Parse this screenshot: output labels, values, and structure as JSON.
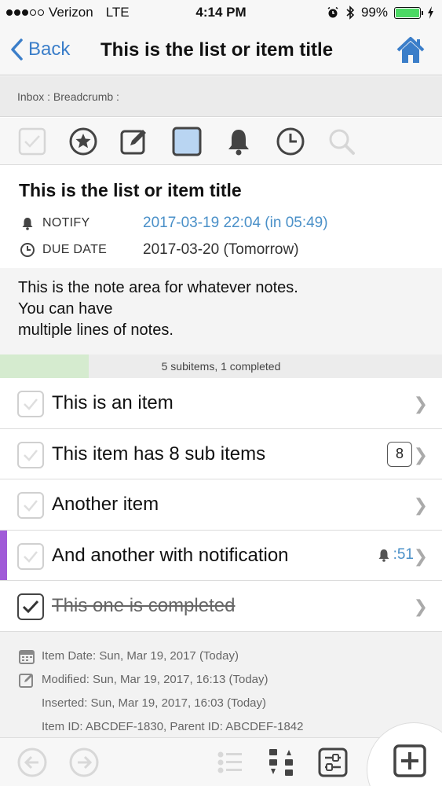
{
  "status_bar": {
    "carrier": "Verizon",
    "network": "LTE",
    "time": "4:14 PM",
    "battery": "99%",
    "battery_level": 0.99
  },
  "nav": {
    "back_label": "Back",
    "title": "This is the list or item title"
  },
  "breadcrumb": "Inbox : Breadcrumb :",
  "toolbar": {
    "icons": [
      "checkbox-icon",
      "star-icon",
      "edit-icon",
      "color-square-icon",
      "bell-icon",
      "clock-icon",
      "search-icon"
    ]
  },
  "item": {
    "title": "This is the list or item title",
    "notify_label": "NOTIFY",
    "notify_value": "2017-03-19 22:04 (in 05:49)",
    "due_label": "DUE DATE",
    "due_value": "2017-03-20 (Tomorrow)",
    "notes": [
      "This is the note area for whatever notes.",
      "You can have",
      "multiple lines of notes."
    ]
  },
  "progress": {
    "text": "5 subitems, 1 completed",
    "fraction": 0.2
  },
  "items": [
    {
      "label": "This is an item",
      "completed": false
    },
    {
      "label": "This item has 8 sub items",
      "completed": false,
      "badge": "8"
    },
    {
      "label": "Another item",
      "completed": false
    },
    {
      "label": "And another with notification",
      "completed": false,
      "notification": ":51",
      "accent": "#a05bd8"
    },
    {
      "label": "This one is completed",
      "completed": true
    }
  ],
  "info": {
    "item_date": "Item Date: Sun, Mar 19, 2017 (Today)",
    "modified": "Modified: Sun, Mar 19, 2017, 16:13 (Today)",
    "inserted": "Inserted: Sun, Mar 19, 2017, 16:03 (Today)",
    "ids": "Item ID: ABCDEF-1830, Parent ID: ABCDEF-1842"
  },
  "colors": {
    "accent_blue": "#3b7ec9",
    "progress_green": "#d5ebcf",
    "notification_purple": "#a05bd8"
  }
}
